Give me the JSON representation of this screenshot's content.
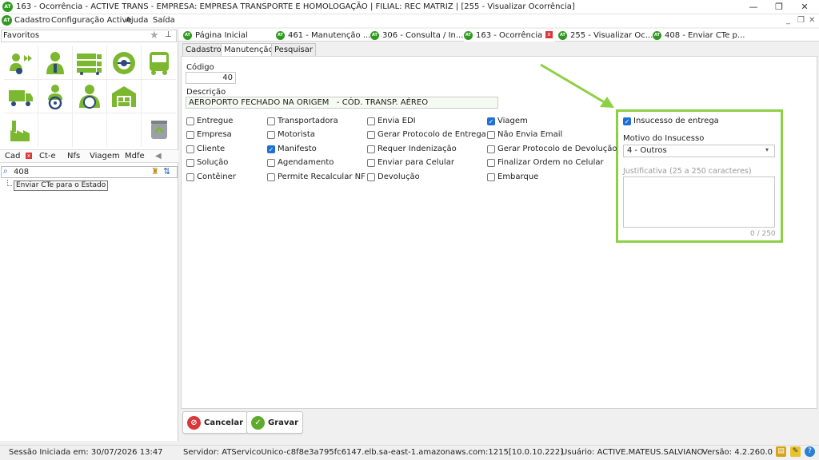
{
  "window": {
    "title": "163 - Ocorrência - ACTIVE TRANS - EMPRESA: EMPRESA TRANSPORTE E HOMOLOGAÇÃO | FILIAL: REC MATRIZ | [255 - Visualizar Ocorrência]",
    "logo_text": "AT",
    "minimize": "—",
    "restore": "❐",
    "close": "✕"
  },
  "menu": {
    "items": [
      "Cadastro",
      "Configuração Active",
      "Ajuda",
      "Saída"
    ],
    "mdi_minimize": "_",
    "mdi_restore": "❐",
    "mdi_close": "✕"
  },
  "favorites": {
    "title": "Favoritos",
    "star": "★",
    "pin": "📌",
    "icons": [
      "truck-arrow-icon",
      "driver-person-icon",
      "trucks-fleet-icon",
      "steering-wheel-badge-icon",
      "bus-icon",
      "box-truck-icon",
      "person-steering-icon",
      "driver-at-wheel-icon",
      "warehouse-icon",
      "",
      "factory-icon",
      "",
      "",
      "",
      "recycle-bin-icon"
    ]
  },
  "left_tabs": [
    "Cad",
    "Ct-e",
    "Nfs",
    "Viagem",
    "Mdfe"
  ],
  "left_tab_close": "x",
  "left_tab_scroll": "◀",
  "search": {
    "value": "408",
    "icon": "🔎",
    "broom": "🧹",
    "sort": "⇅"
  },
  "tree": {
    "items": [
      "Enviar CTe para o Estado"
    ]
  },
  "doc_tabs": [
    "Página Inicial",
    "461 - Manutenção ...",
    "306 - Consulta / In...",
    "163 - Ocorrência",
    "255 - Visualizar Oc...",
    "408 - Enviar CTe p..."
  ],
  "doc_tab_close": "x",
  "sub_tabs": [
    "Cadastro",
    "Manutenção",
    "Pesquisar"
  ],
  "form": {
    "codigo_label": "Código",
    "codigo_value": "40",
    "descricao_label": "Descrição",
    "descricao_value": "AEROPORTO FECHADO NA ORIGEM   - CÓD. TRANSP. AÉREO",
    "checkboxes": {
      "col1": [
        {
          "label": "Entregue",
          "checked": false
        },
        {
          "label": "Empresa",
          "checked": false
        },
        {
          "label": "Cliente",
          "checked": false
        },
        {
          "label": "Solução",
          "checked": false
        },
        {
          "label": "Contêiner",
          "checked": false
        }
      ],
      "col2": [
        {
          "label": "Transportadora",
          "checked": false
        },
        {
          "label": "Motorista",
          "checked": false
        },
        {
          "label": "Manifesto",
          "checked": true
        },
        {
          "label": "Agendamento",
          "checked": false
        },
        {
          "label": "Permite Recalcular NF",
          "checked": false
        }
      ],
      "col3": [
        {
          "label": "Envia EDI",
          "checked": false
        },
        {
          "label": "Gerar Protocolo de Entrega",
          "checked": false
        },
        {
          "label": "Requer Indenização",
          "checked": false
        },
        {
          "label": "Enviar para Celular",
          "checked": false
        },
        {
          "label": "Devolução",
          "checked": false
        }
      ],
      "col4": [
        {
          "label": "Viagem",
          "checked": true
        },
        {
          "label": "Não Envia Email",
          "checked": false
        },
        {
          "label": "Gerar Protocolo de Devolução",
          "checked": false
        },
        {
          "label": "Finalizar Ordem no Celular",
          "checked": false
        },
        {
          "label": "Embarque",
          "checked": false
        }
      ]
    },
    "check_mark": "✓"
  },
  "insucesso": {
    "checkbox_label": "Insucesso de entrega",
    "checked": true,
    "motivo_label": "Motivo do Insucesso",
    "motivo_value": "4 - Outros",
    "motivo_chevron": "⌄",
    "justificativa_placeholder": "Justificativa (25 a 250 caracteres)",
    "counter": "0 / 250",
    "highlight_color": "#8ed044"
  },
  "buttons": {
    "cancel": "Cancelar",
    "save": "Gravar",
    "cancel_icon": "⊘",
    "save_icon": "✓"
  },
  "status": {
    "session": "Sessão Iniciada em: 30/07/2026 13:47",
    "server": "Servidor: ATServicoUnico-c8f8e3a795fc6147.elb.sa-east-1.amazonaws.com:1215[10.0.10.222]",
    "user": "Usuário: ACTIVE.MATEUS.SALVIANO",
    "version": "Versão: 4.2.260.0",
    "icon_a": "▤",
    "icon_b": "✎",
    "icon_c": "?"
  }
}
